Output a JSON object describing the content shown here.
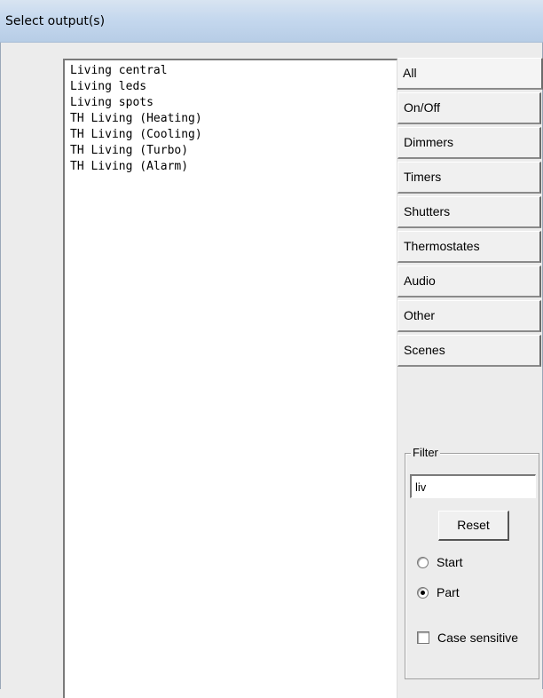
{
  "window": {
    "title": "Select output(s)"
  },
  "outputs": [
    "Living central",
    "Living leds",
    "Living spots",
    "TH Living (Heating)",
    "TH Living (Cooling)",
    "TH Living (Turbo)",
    "TH Living (Alarm)"
  ],
  "tabs": [
    {
      "label": "All",
      "active": true
    },
    {
      "label": "On/Off"
    },
    {
      "label": "Dimmers"
    },
    {
      "label": "Timers"
    },
    {
      "label": "Shutters"
    },
    {
      "label": "Thermostates"
    },
    {
      "label": "Audio"
    },
    {
      "label": "Other"
    },
    {
      "label": "Scenes"
    }
  ],
  "filter": {
    "legend": "Filter",
    "value": "liv",
    "reset_label": "Reset",
    "mode_options": [
      {
        "label": "Start",
        "checked": false
      },
      {
        "label": "Part",
        "checked": true
      }
    ],
    "case_sensitive_label": "Case sensitive",
    "case_sensitive_checked": false
  }
}
